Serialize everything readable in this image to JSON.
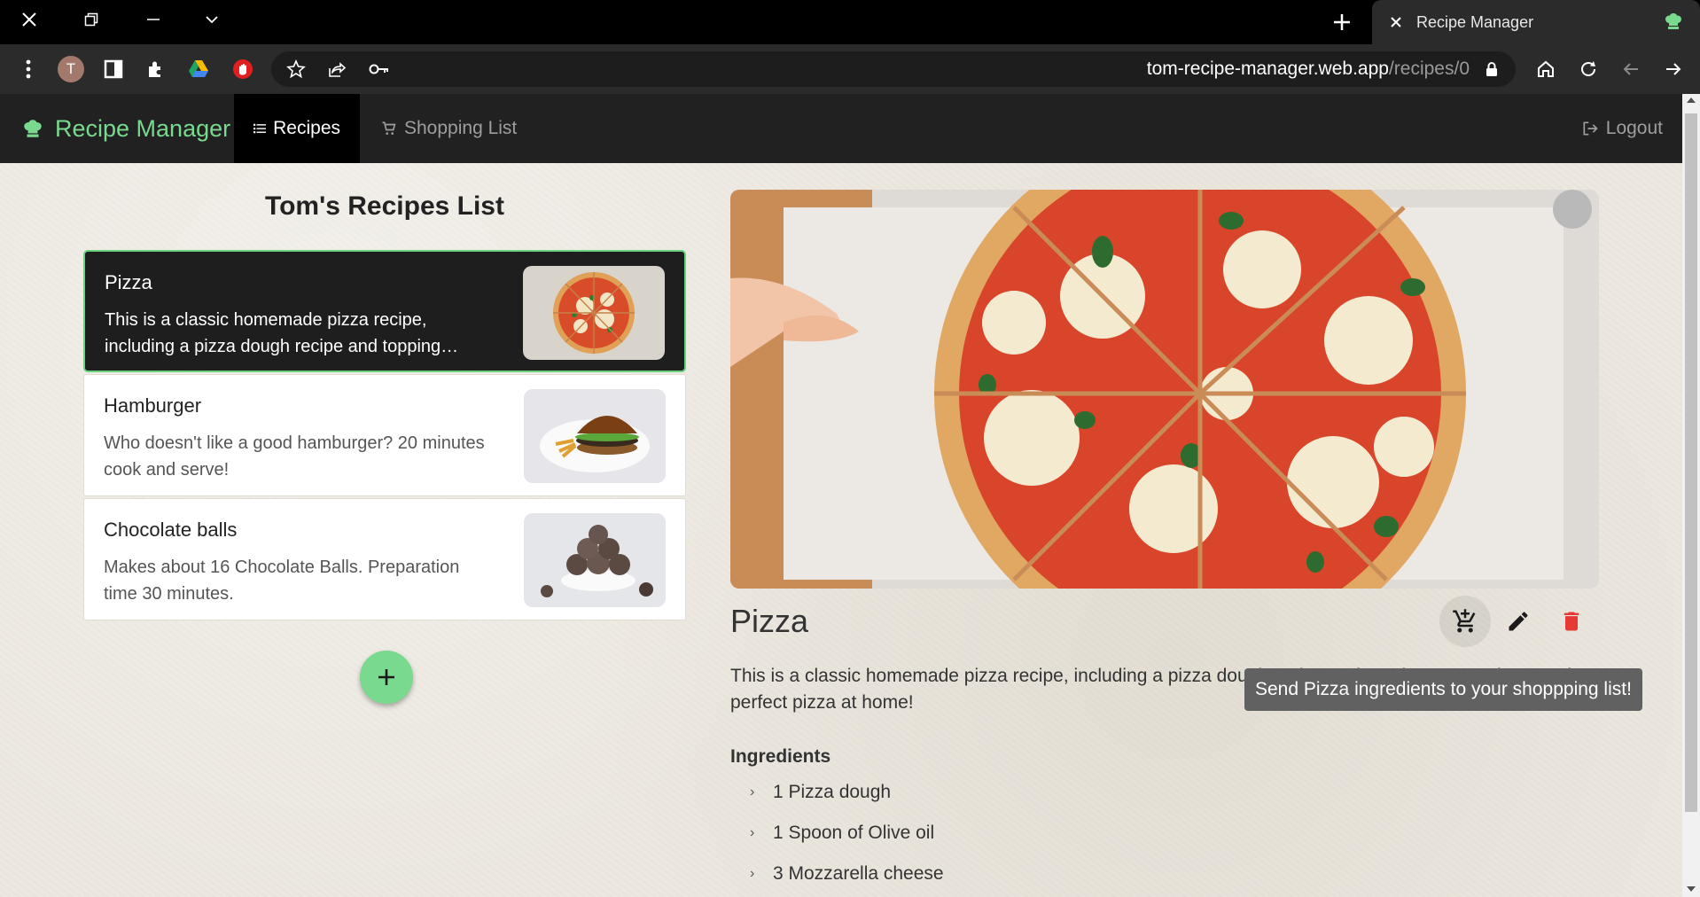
{
  "browser": {
    "tab_title": "Recipe Manager",
    "profile_initial": "T",
    "url_host": "tom-recipe-manager.web.app",
    "url_path": "/recipes/0"
  },
  "navbar": {
    "brand": "Recipe Manager",
    "recipes_label": "Recipes",
    "shopping_label": "Shopping List",
    "logout_label": "Logout"
  },
  "list": {
    "title": "Tom's Recipes List",
    "items": [
      {
        "title": "Pizza",
        "description": "This is a classic homemade pizza recipe, including a pizza dough recipe and topping suggestions. Make perfect pizza at home!",
        "image": "pizza-thumb",
        "active": true
      },
      {
        "title": "Hamburger",
        "description": "Who doesn't like a good hamburger? 20 minutes cook and serve!",
        "image": "hamburger-thumb",
        "active": false
      },
      {
        "title": "Chocolate balls",
        "description": "Makes about 16 Chocolate Balls. Preparation time 30 minutes.",
        "image": "chocolate-balls-thumb",
        "active": false
      }
    ]
  },
  "detail": {
    "title": "Pizza",
    "description": "This is a classic homemade pizza recipe, including a pizza dough recipe and topping suggestions. Make perfect pizza at home!",
    "tooltip": "Send Pizza ingredients to your shoppping list!",
    "ingredients_title": "Ingredients",
    "ingredients": [
      "1 Pizza dough",
      "1 Spoon of Olive oil",
      "3 Mozzarella cheese"
    ]
  },
  "colors": {
    "accent": "#79d98e",
    "navbar": "#212121",
    "delete": "#e53935"
  }
}
